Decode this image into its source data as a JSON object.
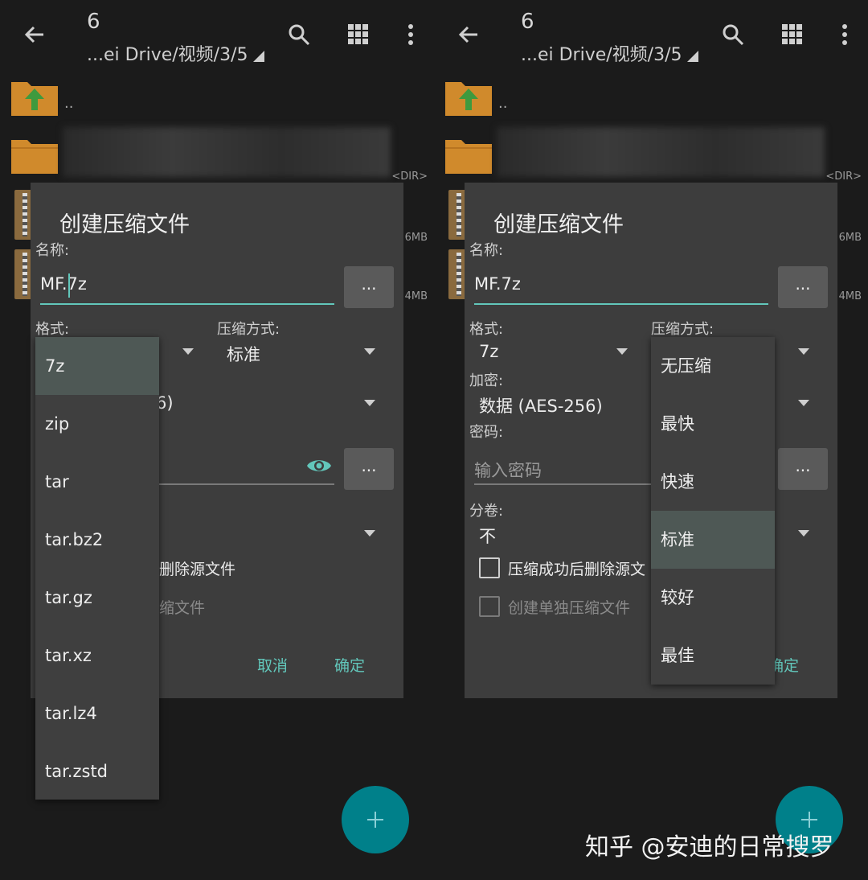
{
  "top": {
    "title": "6",
    "path": "...ei Drive/视频/3/5"
  },
  "files": {
    "parent": "..",
    "dir_tag": "<DIR>",
    "size1": "6MB",
    "size2": "4MB"
  },
  "dialog": {
    "title": "创建压缩文件",
    "name_label": "名称:",
    "name_value": "MF.7z",
    "format_label": "格式:",
    "format_value": "7z",
    "method_label": "压缩方式:",
    "method_value": "标准",
    "encrypt_label": "加密:",
    "encrypt_value": "数据 (AES-256)",
    "encrypt_partial": "6)",
    "password_label": "密码:",
    "password_placeholder": "输入密码",
    "volume_label": "分卷:",
    "volume_value": "不",
    "delete_source": "压缩成功后删除源文",
    "delete_source_partial": "删除源文件",
    "separate": "创建单独压缩文件",
    "separate_partial": "缩文件",
    "cancel": "取消",
    "ok": "确定",
    "ok_partial": "确定",
    "more": "..."
  },
  "format_menu": [
    "7z",
    "zip",
    "tar",
    "tar.bz2",
    "tar.gz",
    "tar.xz",
    "tar.lz4",
    "tar.zstd"
  ],
  "method_menu": [
    "无压缩",
    "最快",
    "快速",
    "标准",
    "较好",
    "最佳"
  ],
  "watermark": "知乎 @安迪的日常搜罗",
  "colors": {
    "accent": "#62c7bb",
    "fab": "#00808a",
    "folder": "#d08a2c"
  },
  "icons": [
    "back-arrow-icon",
    "search-icon",
    "grid-icon",
    "more-vert-icon",
    "folder-icon",
    "eye-icon",
    "add-icon"
  ]
}
